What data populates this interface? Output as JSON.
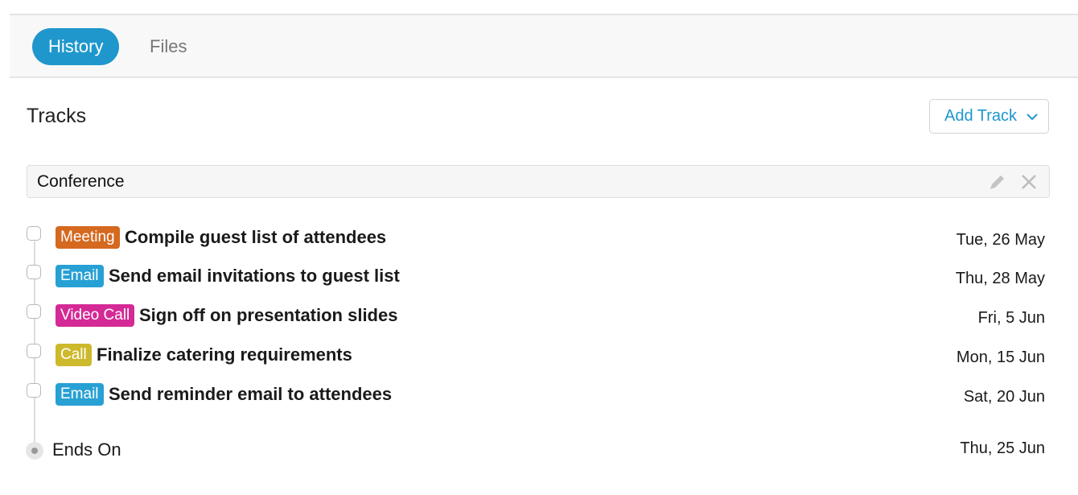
{
  "tabs": [
    {
      "label": "History",
      "active": true
    },
    {
      "label": "Files",
      "active": false
    }
  ],
  "section": {
    "title": "Tracks",
    "add_button_label": "Add Track"
  },
  "group": {
    "name": "Conference",
    "icons": [
      "pencil-icon",
      "close-icon"
    ]
  },
  "tasks": [
    {
      "tag": "Meeting",
      "tag_color": "#d4691f",
      "title": "Compile guest list of attendees",
      "date": "Tue, 26 May"
    },
    {
      "tag": "Email",
      "tag_color": "#27a0d4",
      "title": "Send email invitations to guest list",
      "date": "Thu, 28 May"
    },
    {
      "tag": "Video Call",
      "tag_color": "#d42a96",
      "title": "Sign off on presentation slides",
      "date": "Fri, 5 Jun"
    },
    {
      "tag": "Call",
      "tag_color": "#cdb92c",
      "title": "Finalize catering requirements",
      "date": "Mon, 15 Jun"
    },
    {
      "tag": "Email",
      "tag_color": "#27a0d4",
      "title": "Send reminder email to attendees",
      "date": "Sat, 20 Jun"
    }
  ],
  "end": {
    "label": "Ends On",
    "date": "Thu, 25 Jun"
  }
}
